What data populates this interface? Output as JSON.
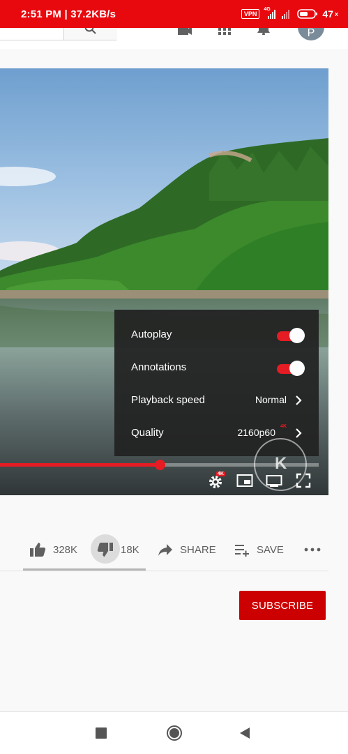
{
  "status_bar": {
    "time_speed": "2:51 PM | 37.2KB/s",
    "vpn": "VPN",
    "network": "4G",
    "battery": "47"
  },
  "header": {
    "avatar_letter": "P"
  },
  "player": {
    "settings": {
      "autoplay": {
        "label": "Autoplay",
        "on": true
      },
      "annotations": {
        "label": "Annotations",
        "on": true
      },
      "playback_speed": {
        "label": "Playback speed",
        "value": "Normal"
      },
      "quality": {
        "label": "Quality",
        "value": "2160p60",
        "badge": "4K"
      }
    },
    "progress_fraction": 0.5,
    "settings_badge": "4K",
    "watermark_letter": "K"
  },
  "actions": {
    "like_count": "328K",
    "dislike_count": "18K",
    "share_label": "SHARE",
    "save_label": "SAVE"
  },
  "channel": {
    "subscribe_label": "SUBSCRIBE"
  },
  "colors": {
    "accent_red": "#e51c23",
    "status_bar": "#e8090f",
    "subscribe": "#cc0000"
  }
}
